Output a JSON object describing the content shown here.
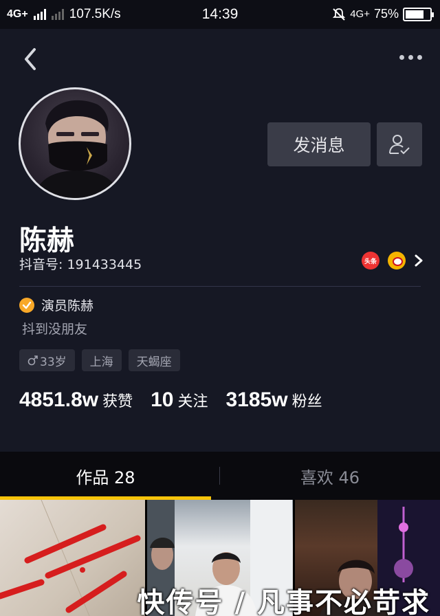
{
  "status_bar": {
    "network_left": "4G+",
    "speed": "107.5K/s",
    "time": "14:39",
    "network_right": "4G+",
    "battery": "75%",
    "battery_level": 0.75
  },
  "profile": {
    "name": "陈赫",
    "douyin_id": "抖音号: 191433445",
    "verified_label": "演员陈赫",
    "bio": "抖到没朋友",
    "tags": [
      {
        "text": "33岁",
        "icon": "male-icon"
      },
      {
        "text": "上海"
      },
      {
        "text": "天蝎座"
      }
    ],
    "stats": [
      {
        "num": "4851.8w",
        "label": "获赞"
      },
      {
        "num": "10",
        "label": "关注"
      },
      {
        "num": "3185w",
        "label": "粉丝"
      }
    ],
    "toutiao_badge": "头条"
  },
  "buttons": {
    "message": "发消息"
  },
  "tabs": [
    {
      "label": "作品 28",
      "active": true
    },
    {
      "label": "喜欢 46",
      "active": false
    }
  ],
  "colors": {
    "background": "#161824",
    "accent": "#f8c40a",
    "verified": "#f8a828"
  },
  "watermark": "快传号 / 凡事不必苛求"
}
